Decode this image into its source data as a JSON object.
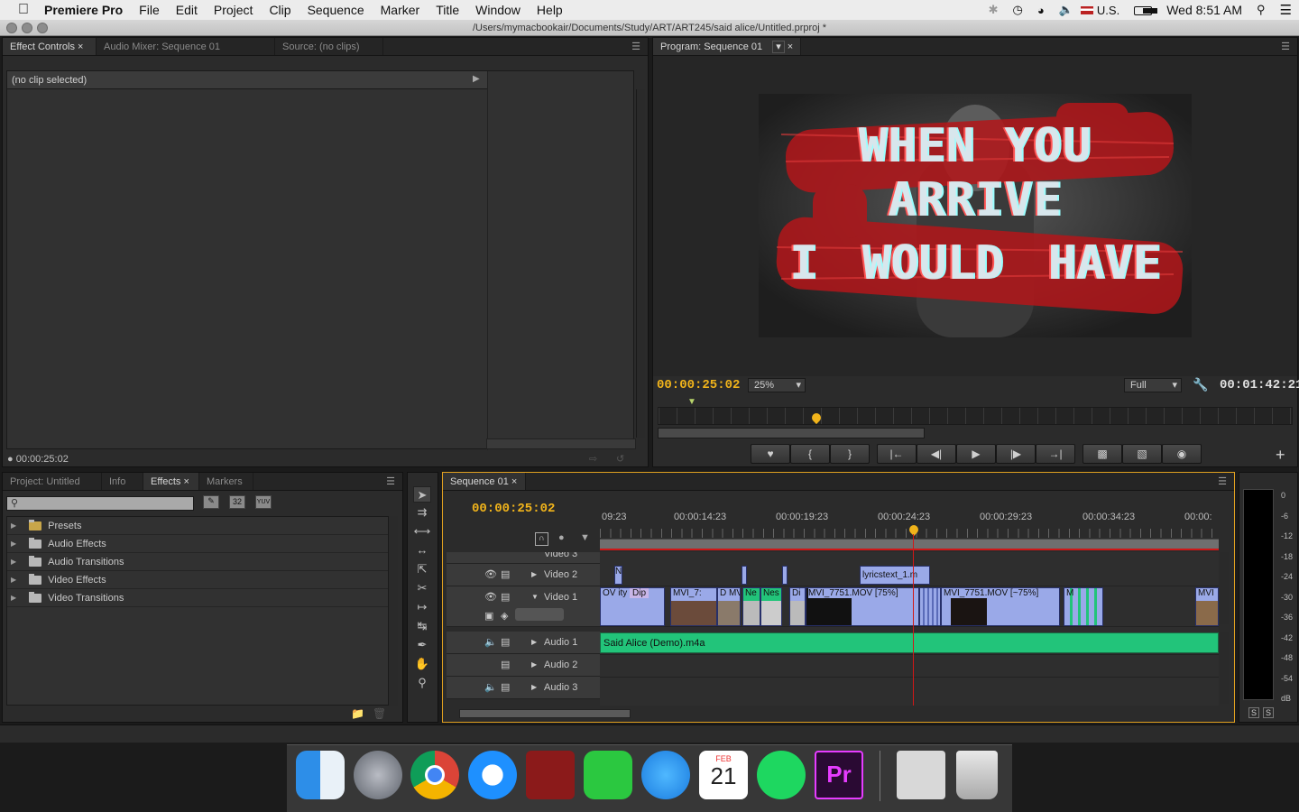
{
  "menubar": {
    "app": "Premiere Pro",
    "items": [
      "File",
      "Edit",
      "Project",
      "Clip",
      "Sequence",
      "Marker",
      "Title",
      "Window",
      "Help"
    ],
    "input_source": "U.S.",
    "clock": "Wed 8:51 AM"
  },
  "window": {
    "path": "/Users/mymacbookair/Documents/Study/ART/ART245/said alice/Untitled.prproj *"
  },
  "effect_controls": {
    "tabs": [
      "Effect Controls",
      "Audio Mixer: Sequence 01",
      "Source: (no clips)"
    ],
    "no_clip": "(no clip selected)",
    "timecode": "00:00:25:02"
  },
  "program": {
    "tab": "Program: Sequence 01",
    "overlay_line1": "WHEN YOU ARRIVE",
    "overlay_line2": "I WOULD HAVE",
    "timecode": "00:00:25:02",
    "zoom": "25%",
    "quality": "Full",
    "duration": "00:01:42:21"
  },
  "project": {
    "tabs": [
      "Project: Untitled",
      "Info",
      "Effects",
      "Markers"
    ],
    "badges": [
      "32",
      "YUV"
    ],
    "effects": [
      "Presets",
      "Audio Effects",
      "Audio Transitions",
      "Video Effects",
      "Video Transitions"
    ]
  },
  "sequence": {
    "tab": "Sequence 01",
    "timecode": "00:00:25:02",
    "ruler": [
      "09:23",
      "00:00:14:23",
      "00:00:19:23",
      "00:00:24:23",
      "00:00:29:23",
      "00:00:34:23",
      "00:00:"
    ],
    "tracks": [
      "Video 3",
      "Video 2",
      "Video 1",
      "Audio 1",
      "Audio 2",
      "Audio 3"
    ],
    "v2_clips": [
      "N",
      "lyricstext_1.m"
    ],
    "v1_clips": [
      "OV",
      "ity",
      "Dip",
      "MVI_7:",
      "D",
      "MV",
      "Ne",
      "Nes",
      "Di",
      "MVI_7751.MOV [75%]",
      "MVI_7751.MOV [~75%]",
      "M",
      "MVI"
    ],
    "audio_clip": "Said Alice (Demo).m4a"
  },
  "meter": {
    "scale": [
      "0",
      "-6",
      "-12",
      "-18",
      "-24",
      "-30",
      "-36",
      "-42",
      "-48",
      "-54",
      "dB"
    ],
    "solo": [
      "S",
      "S"
    ]
  },
  "dock": {
    "calendar_month": "FEB",
    "calendar_day": "21",
    "premiere_label": "Pr"
  },
  "colors": {
    "timecode": "#f1b41b",
    "audio_clip": "#22c47a",
    "video_clip": "#9aa9e8",
    "playhead": "#d01818"
  }
}
